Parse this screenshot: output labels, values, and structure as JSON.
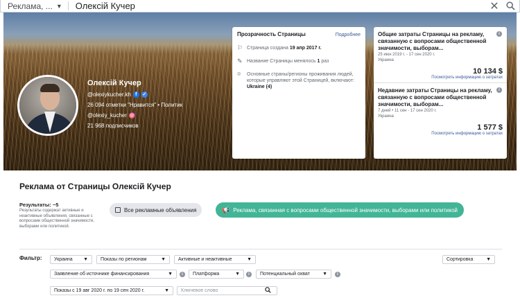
{
  "search": {
    "scope_label": "Реклама, ...",
    "query": "Олексій Кучер"
  },
  "page": {
    "name": "Олексій Кучер",
    "handle": "@olexiykucher.kh",
    "likes_category": "26 094 отметки \"Нравится\" • Политик",
    "instagram": "@olexiy_kucher",
    "followers": "21 968 подписчиков"
  },
  "transparency": {
    "title": "Прозрачность Страницы",
    "more": "Подробнее",
    "created_prefix": "Страница создана ",
    "created_date": "19 апр 2017 г.",
    "renamed_prefix": "Название Страницы менялось ",
    "renamed_count": "1",
    "renamed_suffix": " раз",
    "countries_text": "Основные страны/регионы проживания людей, которые управляют этой Страницей, включают: ",
    "countries_value": "Ukraine (4)"
  },
  "spend": {
    "total": {
      "title": "Общие затраты Страницы на рекламу, связанную с вопросами общественной значимости, выборам...",
      "period": "25 июн 2019 г. - 17 сен 2020 г.",
      "region": "Украина",
      "amount": "10 134 $",
      "link": "Посмотреть информацию о затратах"
    },
    "recent": {
      "title": "Недавние затраты Страницы на рекламу, связанную с вопросами общественной значимости, выборам...",
      "period": "7 дней • 11 сен - 17 сен 2020 г.",
      "region": "Украина",
      "amount": "1 577 $",
      "link": "Посмотреть информацию о затратах"
    }
  },
  "section_title": "Реклама от Страницы Олексій Кучер",
  "results": {
    "head": "Результаты: ~5",
    "desc": "Результаты содержат активные и неактивные объявления, связанные с вопросами общественной значимости, выборами или политикой."
  },
  "tabs": {
    "all": "Все рекламные объявления",
    "political": "Реклама, связанная с вопросами общественной значимости, выборами или политикой"
  },
  "filters": {
    "label": "Фильтр:",
    "country": "Украина",
    "impressions_region": "Показы по регионам",
    "status": "Активные и неактивные",
    "sort": "Сортировка",
    "disclaimer": "Заявление об источнике финансирования",
    "platform": "Платформа",
    "reach": "Потенциальный охват",
    "dates": "Показы с 19 авг 2020 г. по 19 сен 2020 г.",
    "keyword_placeholder": "Ключевое слово"
  },
  "colors": {
    "accent_green": "#42b596",
    "link_blue": "#385898",
    "pill_gray": "#e4e6eb"
  }
}
